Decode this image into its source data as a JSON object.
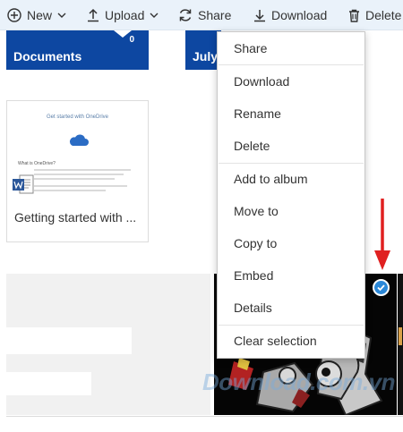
{
  "toolbar": {
    "new_label": "New",
    "upload_label": "Upload",
    "share_label": "Share",
    "download_label": "Download",
    "delete_label": "Delete"
  },
  "folders": [
    {
      "name": "Documents",
      "count": "0"
    },
    {
      "name": "July"
    }
  ],
  "document": {
    "preview_title": "Get started with OneDrive",
    "preview_subtitle": "What is OneDrive?",
    "caption": "Getting started with ..."
  },
  "context_menu": {
    "items": [
      "Share",
      "Download",
      "Rename",
      "Delete",
      "Add to album",
      "Move to",
      "Copy to",
      "Embed",
      "Details",
      "Clear selection"
    ]
  },
  "watermark": "Download.com.vn",
  "colors": {
    "toolbar_bg": "#eaf2fa",
    "folder_tile": "#0d47a1",
    "accent": "#2b88d8",
    "annotation_arrow": "#e02020"
  },
  "icons": [
    "plus-circle-icon",
    "upload-icon",
    "share-icon",
    "download-icon",
    "trash-icon",
    "cloud-icon",
    "word-icon",
    "checkmark-icon"
  ]
}
